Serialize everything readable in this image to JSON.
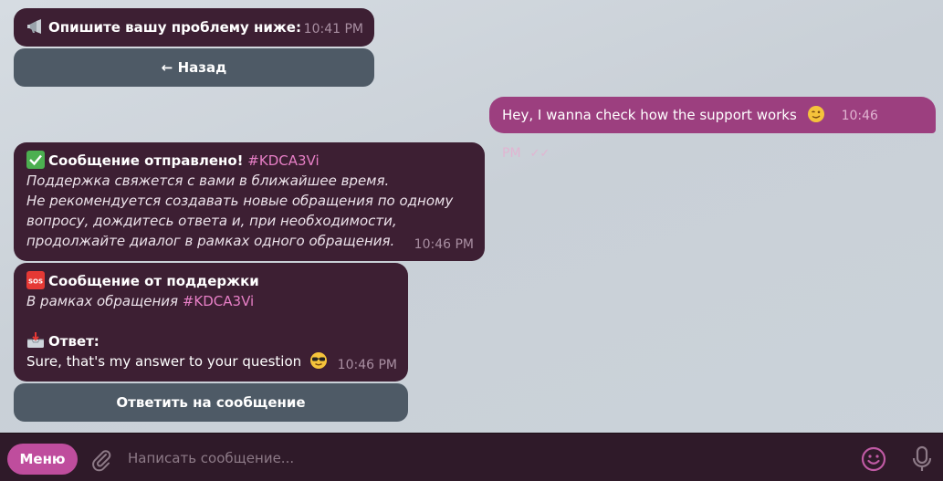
{
  "messages": {
    "prompt": {
      "text": "Опишите вашу проблему ниже:",
      "time": "10:41 PM",
      "icon": "megaphone-icon"
    },
    "back_button": "← Назад",
    "user": {
      "text": "Hey, I wanna check how the support works",
      "emoji": "winking-face-icon",
      "time": "10:46 PM",
      "status": "✓✓"
    },
    "sent": {
      "title": "Сообщение отправлено!",
      "tag": "#KDCA3Vi",
      "icon": "check-mark-icon",
      "line1": "Поддержка свяжется с вами в ближайшее время.",
      "line2": "Не рекомендуется создавать новые обращения по одному",
      "line3": "вопросу, дождитесь ответа и, при необходимости,",
      "line4": "продолжайте диалог в рамках одного обращения.",
      "time": "10:46 PM"
    },
    "support": {
      "title": "Сообщение от поддержки",
      "icon": "sos-icon",
      "subtitle": "В рамках обращения",
      "tag": "#KDCA3Vi",
      "answer_label": "Ответ:",
      "answer_icon": "inbox-tray-icon",
      "answer": "Sure, that's my answer to your question",
      "answer_emoji": "sunglasses-face-icon",
      "time": "10:46 PM"
    },
    "reply_button": "Ответить на сообщение"
  },
  "composer": {
    "menu_label": "Меню",
    "placeholder": "Написать сообщение..."
  },
  "colors": {
    "bot_bubble": "#3d1f33",
    "user_bubble": "#9c3f7f",
    "keyboard_button": "#4e5a66",
    "menu_button": "#bf4d9d",
    "tag": "#e77fc6"
  }
}
